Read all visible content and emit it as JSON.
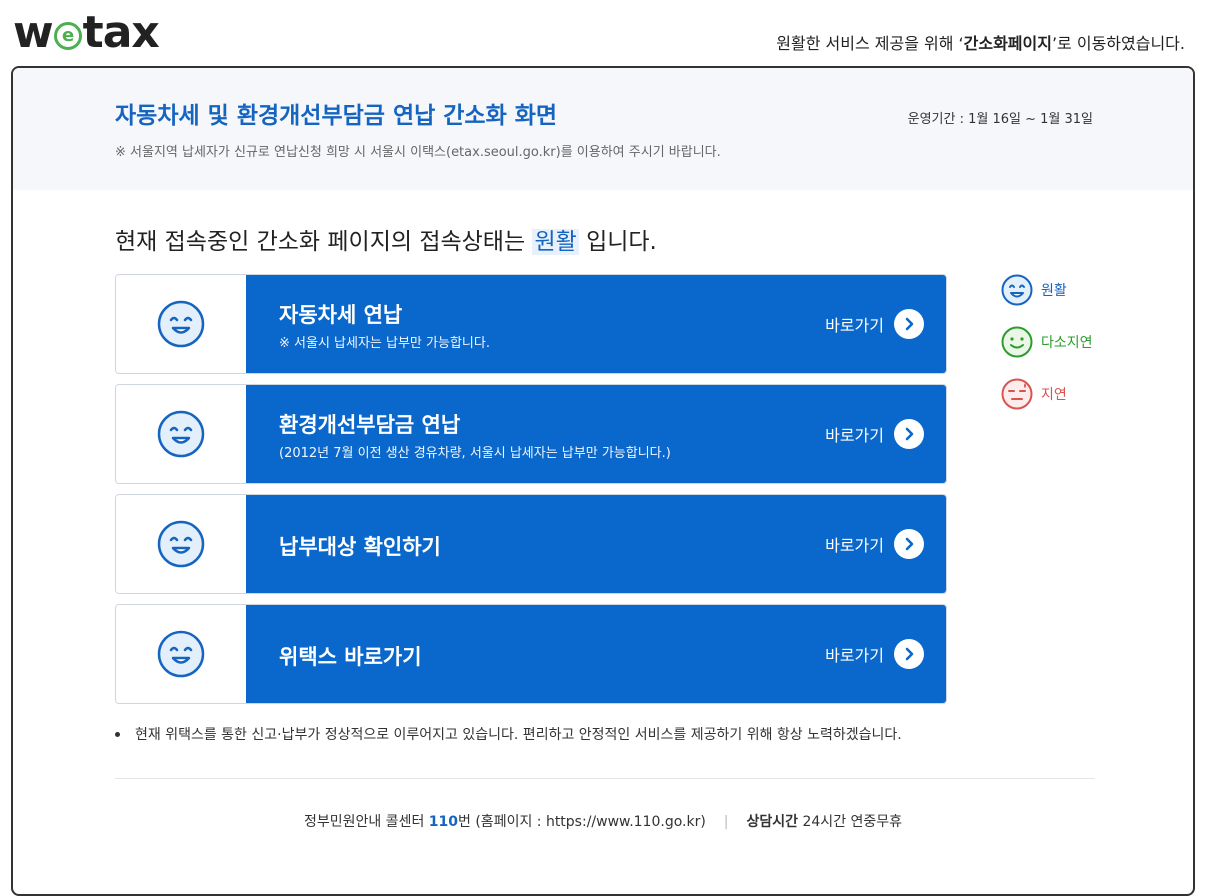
{
  "header": {
    "logo_before": "w",
    "logo_e": "e",
    "logo_after": "tax",
    "notice_prefix": "원활한 서비스 제공을 위해 ‘",
    "notice_highlight": "간소화페이지",
    "notice_suffix": "’로 이동하였습니다."
  },
  "panel": {
    "title": "자동차세 및 환경개선부담금 연납 간소화 화면",
    "period": "운영기간 : 1월 16일 ~ 1월 31일",
    "subnote": "※ 서울지역 납세자가 신규로 연납신청 희망 시 서울시 이택스(etax.seoul.go.kr)를 이용하여 주시기 바랍니다."
  },
  "status": {
    "prefix": "현재 접속중인 간소화 페이지의 접속상태는 ",
    "state": "원활",
    "suffix": " 입니다."
  },
  "menu": [
    {
      "label": "자동차세 연납",
      "desc": "※ 서울시 납세자는 납부만 가능합니다.",
      "go": "바로가기"
    },
    {
      "label": "환경개선부담금 연납",
      "desc": "(2012년 7월 이전 생산 경유차량, 서울시 납세자는 납부만 가능합니다.)",
      "go": "바로가기"
    },
    {
      "label": "납부대상 확인하기",
      "desc": "",
      "go": "바로가기"
    },
    {
      "label": "위택스 바로가기",
      "desc": "",
      "go": "바로가기"
    }
  ],
  "legend": [
    {
      "label": "원활",
      "color": "#1565c0",
      "icon": "smile-icon"
    },
    {
      "label": "다소지연",
      "color": "#2e9b2e",
      "icon": "neutral-smile-icon"
    },
    {
      "label": "지연",
      "color": "#d9534f",
      "icon": "sweat-face-icon"
    }
  ],
  "info": "현재 위택스를 통한 신고·납부가 정상적으로 이루어지고 있습니다. 편리하고 안정적인 서비스를 제공하기 위해 항상 노력하겠습니다.",
  "footer": {
    "call_prefix": "정부민원안내 콜센터 ",
    "call_number": "110",
    "call_suffix": "번 (홈페이지 : https://www.110.go.kr)",
    "separator": "|",
    "hours_label": "상담시간",
    "hours_value": " 24시간 연중무휴"
  },
  "colors": {
    "brand_blue": "#0a68cc",
    "title_blue": "#1565c0"
  }
}
